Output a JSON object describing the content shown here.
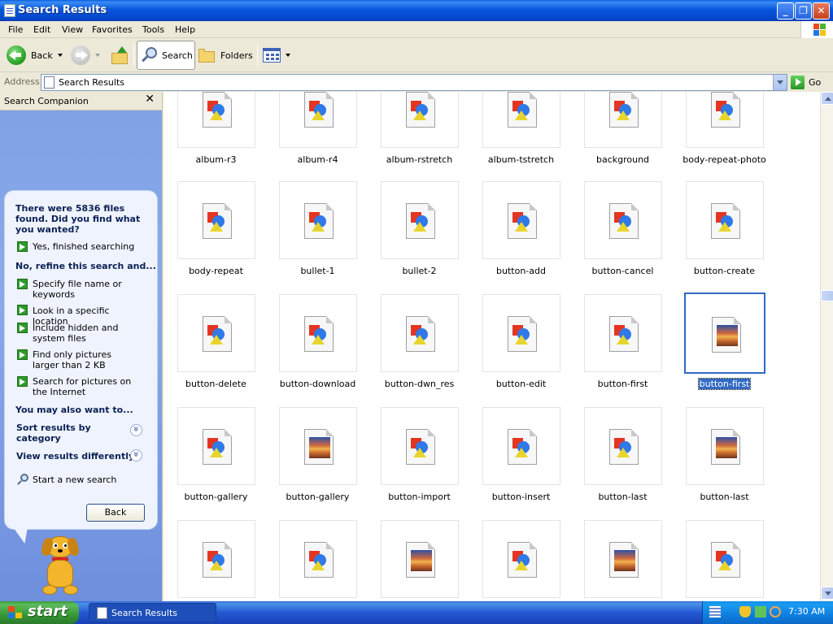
{
  "window": {
    "title": "Search Results"
  },
  "menubar": {
    "items": [
      "File",
      "Edit",
      "View",
      "Favorites",
      "Tools",
      "Help"
    ]
  },
  "toolbar": {
    "back_label": "Back",
    "search_label": "Search",
    "folders_label": "Folders"
  },
  "address": {
    "label": "Address",
    "value": "Search Results",
    "go_label": "Go"
  },
  "companion": {
    "title": "Search Companion",
    "question": "There were 5836 files found. Did you find what you wanted?",
    "yes_finished": "Yes, finished searching",
    "refine_heading": "No, refine this search and...",
    "refine_items": [
      "Specify file name or keywords",
      "Look in a specific location",
      "Include hidden and system files",
      "Find only pictures larger than 2 KB",
      "Search for pictures on the Internet"
    ],
    "also_heading": "You may also want to...",
    "sort_results": "Sort results by category",
    "view_results": "View results differently",
    "new_search": "Start a new search",
    "back_button": "Back"
  },
  "files": [
    [
      "album-r3",
      "album-r4",
      "album-rstretch",
      "album-tstretch",
      "background",
      "body-repeat-photo"
    ],
    [
      "body-repeat",
      "bullet-1",
      "bullet-2",
      "button-add",
      "button-cancel",
      "button-create"
    ],
    [
      "button-delete",
      "button-download",
      "button-dwn_res",
      "button-edit",
      "button-first",
      "button-first"
    ],
    [
      "button-gallery",
      "button-gallery",
      "button-import",
      "button-insert",
      "button-last",
      "button-last"
    ],
    [
      "",
      "",
      "",
      "",
      "",
      ""
    ]
  ],
  "file_types": [
    [
      "shapes",
      "shapes",
      "shapes",
      "shapes",
      "shapes",
      "shapes"
    ],
    [
      "shapes",
      "shapes",
      "shapes",
      "shapes",
      "shapes",
      "shapes"
    ],
    [
      "shapes",
      "shapes",
      "shapes",
      "shapes",
      "shapes",
      "photo"
    ],
    [
      "shapes",
      "photo",
      "shapes",
      "shapes",
      "shapes",
      "photo"
    ],
    [
      "shapes",
      "shapes",
      "photo",
      "shapes",
      "photo",
      "shapes"
    ]
  ],
  "selected": {
    "row": 2,
    "col": 5
  },
  "taskbar": {
    "start_label": "start",
    "task_label": "Search Results",
    "clock": "7:30 AM"
  },
  "colors": {
    "selection": "#316ac5",
    "titlebar": "#0856dc"
  }
}
